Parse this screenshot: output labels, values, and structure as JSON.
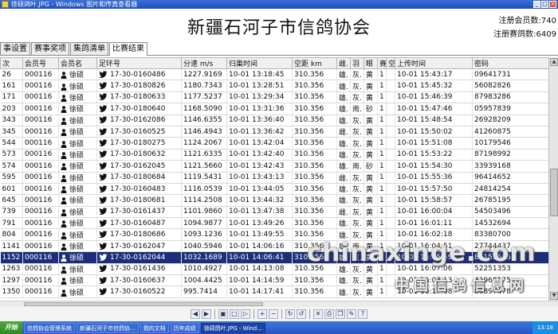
{
  "window": {
    "title": "徐硕鸽叶.JPG - Windows 图片和传真查看器"
  },
  "header": {
    "title": "新疆石河子市信鸽协会",
    "member_count_label": "注册会员数:740",
    "pigeon_count_label": "注册赛鸽数:6409"
  },
  "tabs": [
    {
      "label": "事设置"
    },
    {
      "label": "赛事奖项"
    },
    {
      "label": "集鸽清单"
    },
    {
      "label": "比赛结果"
    }
  ],
  "columns": [
    "次",
    "会员号",
    "会员名",
    "足环号",
    "分速 m/s",
    "归巢时间",
    "空距 km",
    "雌.",
    "羽",
    "眼",
    "赛",
    "空",
    "上传时间",
    "密码"
  ],
  "rows": [
    [
      "26",
      "000116",
      "徐硕",
      "17-30-0160486",
      "1227.9169",
      "10-01 13:18:45",
      "310.356",
      "雄.",
      "灰.",
      "黄",
      "1",
      "",
      "10-01 15:43:17",
      "09641731"
    ],
    [
      "161",
      "000116",
      "徐硕",
      "17-30-0180826",
      "1180.7343",
      "10-01 13:28:51",
      "310.356",
      "雄.",
      "灰.",
      "黄",
      "1",
      "",
      "10-01 15:45:32",
      "56082826"
    ],
    [
      "171",
      "000116",
      "徐硕",
      "17-30-0180633",
      "1177.5237",
      "10-01 13:29:34",
      "310.356",
      "雄.",
      "灰.",
      "黄",
      "1",
      "",
      "10-01 15:46:39",
      "87983286"
    ],
    [
      "203",
      "000116",
      "徐硕",
      "17-30-0180640",
      "1168.5090",
      "10-01 13:31:36",
      "310.356",
      "雄.",
      "雨.",
      "砂",
      "1",
      "",
      "10-01 15:47:46",
      "05957839"
    ],
    [
      "343",
      "000116",
      "徐硕",
      "17-30-0162086",
      "1146.6355",
      "10-01 13:36:40",
      "310.356",
      "雄.",
      "灰.",
      "黄",
      "1",
      "",
      "10-01 15:48:54",
      "26928209"
    ],
    [
      "345",
      "000116",
      "徐硕",
      "17-30-0160525",
      "1146.4943",
      "10-01 13:36:42",
      "310.356",
      "雌.",
      "灰.",
      "黄",
      "1",
      "",
      "10-01 15:50:02",
      "41260875"
    ],
    [
      "544",
      "000116",
      "徐硕",
      "17-30-0180275",
      "1124.2067",
      "10-01 13:42:04",
      "310.356",
      "雄.",
      "灰.",
      "黄",
      "1",
      "",
      "10-01 15:51:08",
      "10179546"
    ],
    [
      "573",
      "000116",
      "徐硕",
      "17-30-0180632",
      "1121.6335",
      "10-01 13:42:40",
      "310.356",
      "雄.",
      "灰.",
      "黄",
      "1",
      "",
      "10-01 15:53:22",
      "87198992"
    ],
    [
      "574",
      "000116",
      "徐硕",
      "17-30-0162045",
      "1121.5660",
      "10-01 13:42:43",
      "310.356",
      "雄.",
      "雨.",
      "砂",
      "1",
      "",
      "10-01 15:54:30",
      "33939168"
    ],
    [
      "595",
      "000116",
      "徐硕",
      "17-30-0180684",
      "1119.5431",
      "10-01 13:43:13",
      "310.356",
      "雌.",
      "灰.",
      "黄",
      "1",
      "",
      "10-01 15:55:36",
      "96414652"
    ],
    [
      "601",
      "000116",
      "徐硕",
      "17-30-0160483",
      "1116.0539",
      "10-01 13:44:05",
      "310.356",
      "雄.",
      "灰.",
      "黄",
      "1",
      "",
      "10-01 15:57:50",
      "24814254"
    ],
    [
      "645",
      "000116",
      "徐硕",
      "17-30-0180681",
      "1114.2508",
      "10-01 13:44:32",
      "310.356",
      "雄.",
      "灰.",
      "黄",
      "1",
      "",
      "10-01 15:58:57",
      "26785195"
    ],
    [
      "739",
      "000116",
      "徐硕",
      "17-30-0161437",
      "1101.9860",
      "10-01 13:47:38",
      "310.356",
      "雌.",
      "灰.",
      "黄",
      "1",
      "",
      "10-01 16:00:04",
      "54503496"
    ],
    [
      "791",
      "000116",
      "徐硕",
      "17-30-0160487",
      "1094.9877",
      "10-01 13:49:26",
      "310.356",
      "雄.",
      "灰.",
      "黄",
      "1",
      "",
      "10-01 16:01:11",
      "14532694"
    ],
    [
      "804",
      "000116",
      "徐硕",
      "17-30-0180686",
      "1093.1236",
      "10-01 13:49:55",
      "310.356",
      "雄.",
      "灰.",
      "黄",
      "1",
      "",
      "10-01 16:02:18",
      "83380700"
    ],
    [
      "1141",
      "000116",
      "徐硕",
      "17-30-0162047",
      "1040.5946",
      "10-01 14:06:16",
      "310.356",
      "雄.",
      "雨.",
      "黄",
      "1",
      "",
      "10-01 16:04:51",
      "27744437"
    ],
    [
      "1152",
      "000116",
      "徐硕",
      "17-30-0162044",
      "1032.1689",
      "10-01 14:06:41",
      "310.356",
      "雄.",
      "灰.",
      "黄",
      "1",
      "",
      "10-01 16:05:59",
      "84152536"
    ],
    [
      "1263",
      "000116",
      "徐硕",
      "17-30-0161436",
      "1010.4927",
      "10-01 14:13:08",
      "310.356",
      "雄.",
      "灰.",
      "黄",
      "1",
      "",
      "10-01 16:07:06",
      "52251353"
    ],
    [
      "1297",
      "000116",
      "徐硕",
      "17-30-0160637",
      "1004.4425",
      "10-01 14:14:59",
      "310.356",
      "雄.",
      "灰.",
      "黄",
      "1",
      "",
      "10-01 16:08:13",
      "46968575"
    ],
    [
      "1350",
      "000116",
      "徐硕",
      "17-30-0160522",
      "995.7414",
      "10-01 14:17:41",
      "310.356",
      "雄.",
      "灰.",
      "黄",
      "1",
      "",
      "10-01 16:17:08",
      "86897478"
    ]
  ],
  "selected_row_index": 16,
  "icons": {
    "member": "person-icon",
    "ring": "bird-icon"
  },
  "watermark": {
    "main": "chinaxinge.com",
    "sub": "中国信鸽信息网"
  },
  "viewer_toolbar": {
    "buttons": [
      "prev-icon",
      "next-icon",
      "best-fit-icon",
      "actual-size-icon",
      "slideshow-icon",
      "zoom-in-icon",
      "zoom-out-icon",
      "rotate-cw-icon",
      "rotate-ccw-icon",
      "delete-icon",
      "print-icon",
      "copy-icon",
      "edit-icon",
      "help-icon"
    ]
  },
  "taskbar": {
    "start_label": "开始",
    "tasks": [
      {
        "label": "信鸽协会管理系统"
      },
      {
        "label": "新疆石河子市信鸽协..."
      },
      {
        "label": "我的文档"
      },
      {
        "label": "历年成绩"
      },
      {
        "label": "徐硕鸽叶.JPG - Wind..."
      }
    ],
    "clock": "13:18"
  },
  "colors": {
    "selected_row": "#1c2e7a",
    "titlebar": "#2556c4",
    "start_button": "#3a9a2e"
  }
}
